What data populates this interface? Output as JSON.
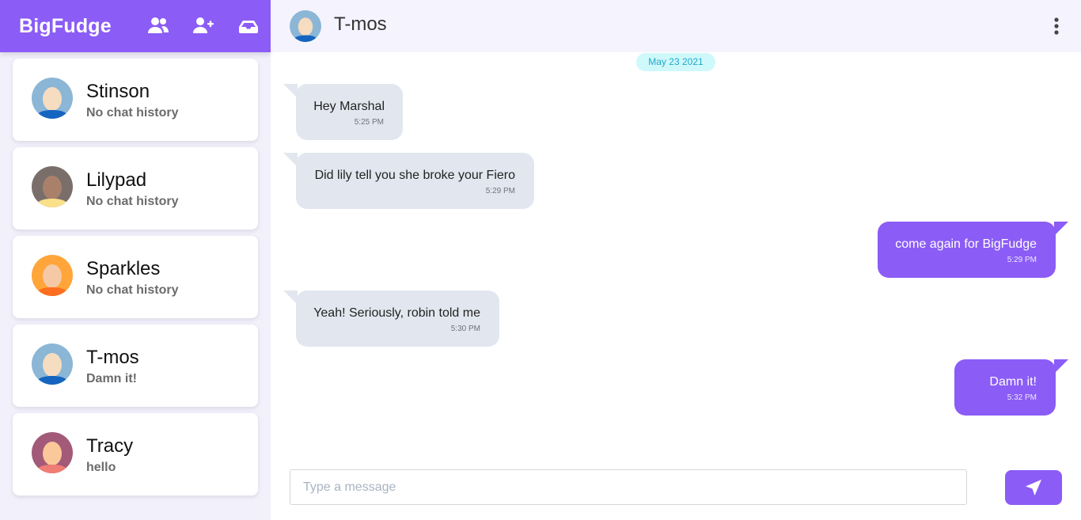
{
  "app": {
    "brand": "BigFudge"
  },
  "colors": {
    "accent": "#8b5cf6",
    "sidebar_bg": "#f2f0fb",
    "incoming_bubble": "#e2e7ef",
    "date_chip_bg": "#cff8fb"
  },
  "header_icons": [
    "users-icon",
    "add-user-icon",
    "inbox-icon"
  ],
  "contacts": [
    {
      "name": "Stinson",
      "preview": "No chat history"
    },
    {
      "name": "Lilypad",
      "preview": "No chat history"
    },
    {
      "name": "Sparkles",
      "preview": "No chat history"
    },
    {
      "name": "T-mos",
      "preview": "Damn it!"
    },
    {
      "name": "Tracy",
      "preview": "hello"
    }
  ],
  "chat": {
    "name": "T-mos",
    "date": "May 23 2021",
    "messages": [
      {
        "direction": "in",
        "text": "Hey Marshal",
        "time": "5:25 PM"
      },
      {
        "direction": "in",
        "text": "Did lily tell you she broke your Fiero",
        "time": "5:29 PM"
      },
      {
        "direction": "out",
        "text": "come again for BigFudge",
        "time": "5:29 PM"
      },
      {
        "direction": "in",
        "text": "Yeah! Seriously, robin told me",
        "time": "5:30 PM"
      },
      {
        "direction": "out",
        "text": "Damn it!",
        "time": "5:32 PM"
      }
    ]
  },
  "composer": {
    "placeholder": "Type a message",
    "value": ""
  }
}
